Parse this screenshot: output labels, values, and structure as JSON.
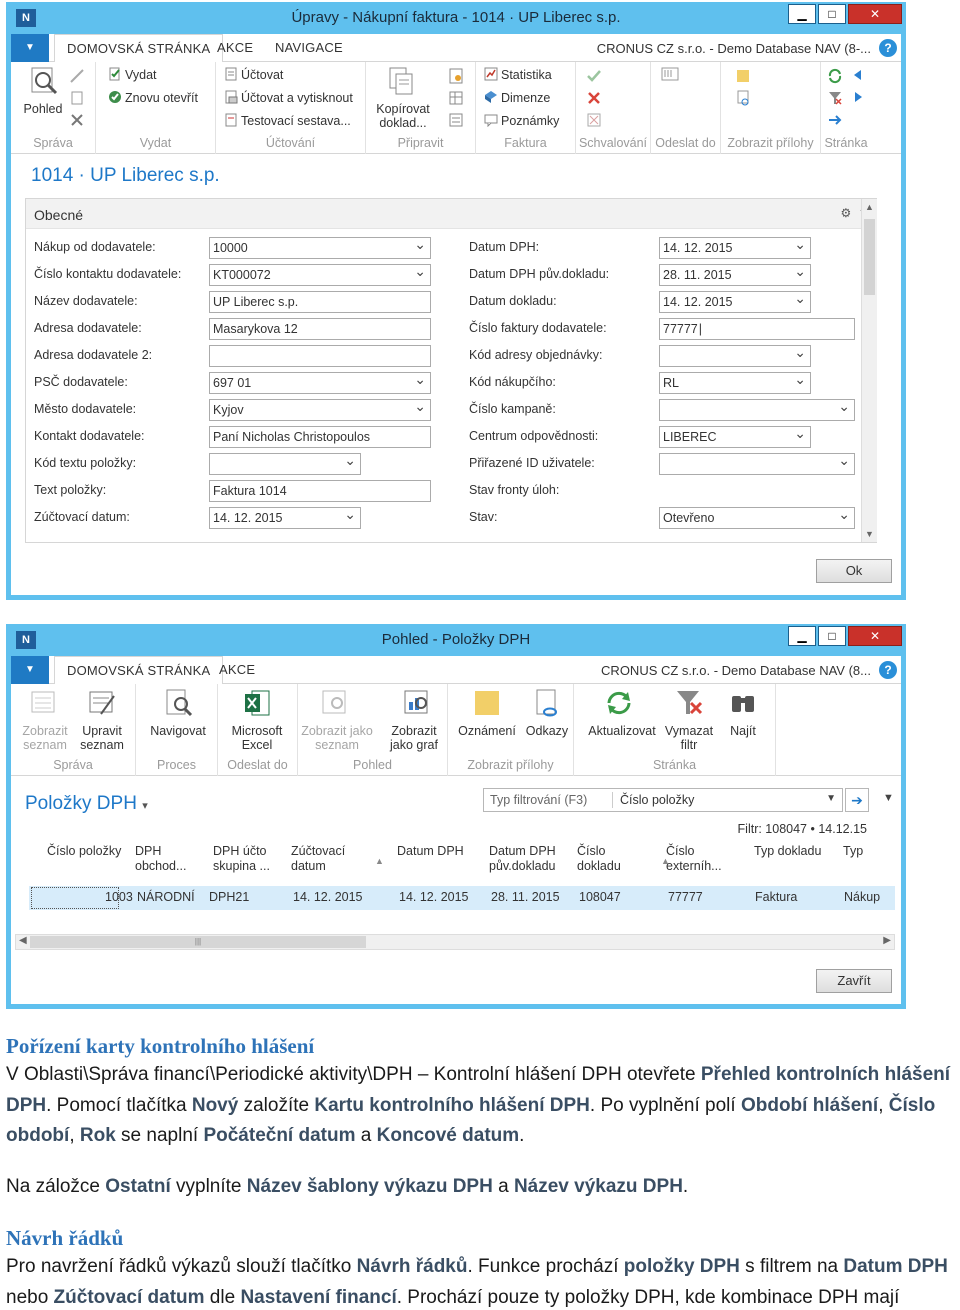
{
  "window1": {
    "title": "Úpravy - Nákupní faktura - 1014 · UP Liberec s.p.",
    "logo": "N",
    "controls": {
      "minimize": "▁",
      "maximize": "□",
      "close": "✕"
    },
    "tabs": [
      "DOMOVSKÁ STRÁNKA",
      "AKCE",
      "NAVIGACE"
    ],
    "company": "CRONUS CZ s.r.o. - Demo Database NAV (8-...",
    "help": "?",
    "ribbon": {
      "sprava": {
        "group": "Správa",
        "view": "Pohled"
      },
      "vydat": {
        "group": "Vydat",
        "post": "Vydat",
        "reopen": "Znovu otevřít"
      },
      "uctovani": {
        "group": "Účtování",
        "post": "Účtovat",
        "post_print": "Účtovat a vytisknout",
        "test": "Testovací sestava..."
      },
      "pripravit": {
        "group": "Připravit",
        "copy": "Kopírovat",
        "copy2": "doklad..."
      },
      "faktura": {
        "group": "Faktura",
        "stats": "Statistika",
        "dims": "Dimenze",
        "notes": "Poznámky"
      },
      "schvalovani": {
        "group": "Schvalování"
      },
      "odeslat": {
        "group": "Odeslat do"
      },
      "prilohy": {
        "group": "Zobrazit přílohy"
      },
      "stranka": {
        "group": "Stránka"
      }
    },
    "record_title": "1014 · UP Liberec s.p.",
    "fasttab": "Obecné",
    "left_fields": [
      {
        "label": "Nákup od dodavatele:",
        "value": "10000"
      },
      {
        "label": "Číslo kontaktu dodavatele:",
        "value": "KT000072"
      },
      {
        "label": "Název dodavatele:",
        "value": "UP Liberec s.p."
      },
      {
        "label": "Adresa dodavatele:",
        "value": "Masarykova 12"
      },
      {
        "label": "Adresa dodavatele 2:",
        "value": ""
      },
      {
        "label": "PSČ dodavatele:",
        "value": "697 01"
      },
      {
        "label": "Město dodavatele:",
        "value": "Kyjov"
      },
      {
        "label": "Kontakt dodavatele:",
        "value": "Paní Nicholas Christopoulos"
      },
      {
        "label": "Kód textu položky:",
        "value": ""
      },
      {
        "label": "Text položky:",
        "value": "Faktura 1014"
      },
      {
        "label": "Zúčtovací datum:",
        "value": "14. 12. 2015"
      }
    ],
    "right_fields": [
      {
        "label": "Datum DPH:",
        "value": "14. 12. 2015"
      },
      {
        "label": "Datum DPH pův.dokladu:",
        "value": "28. 11. 2015"
      },
      {
        "label": "Datum dokladu:",
        "value": "14. 12. 2015"
      },
      {
        "label": "Číslo faktury dodavatele:",
        "value": "77777"
      },
      {
        "label": "Kód adresy objednávky:",
        "value": ""
      },
      {
        "label": "Kód nákupčího:",
        "value": "RL"
      },
      {
        "label": "Číslo kampaně:",
        "value": ""
      },
      {
        "label": "Centrum odpovědnosti:",
        "value": "LIBEREC"
      },
      {
        "label": "Přiřazené ID uživatele:",
        "value": ""
      },
      {
        "label": "Stav fronty úloh:",
        "value": ""
      },
      {
        "label": "Stav:",
        "value": "Otevřeno"
      }
    ],
    "ok": "Ok"
  },
  "window2": {
    "title": "Pohled - Položky DPH",
    "logo": "N",
    "controls": {
      "minimize": "▁",
      "maximize": "□",
      "close": "✕"
    },
    "tabs": [
      "DOMOVSKÁ STRÁNKA",
      "AKCE"
    ],
    "company": "CRONUS CZ s.r.o. - Demo Database NAV (8...",
    "help": "?",
    "ribbon": {
      "sprava": {
        "group": "Správa",
        "show_list": "Zobrazit",
        "show_list2": "seznam",
        "edit_list": "Upravit",
        "edit_list2": "seznam"
      },
      "proces": {
        "group": "Proces",
        "navigate": "Navigovat"
      },
      "odeslat": {
        "group": "Odeslat do",
        "excel": "Microsoft",
        "excel2": "Excel"
      },
      "pohled": {
        "group": "Pohled",
        "as_list": "Zobrazit jako",
        "as_list2": "seznam",
        "as_chart": "Zobrazit",
        "as_chart2": "jako graf"
      },
      "prilohy": {
        "group": "Zobrazit přílohy",
        "notes": "Oznámení",
        "links": "Odkazy"
      },
      "stranka": {
        "group": "Stránka",
        "refresh": "Aktualizovat",
        "clear": "Vymazat",
        "clear2": "filtr",
        "find": "Najít"
      }
    },
    "page_title": "Položky DPH",
    "filter_type": "Typ filtrování (F3)",
    "filter_field": "Číslo položky",
    "filter_text": "Filtr: 108047 • 14.12.15",
    "columns": [
      [
        "Číslo položky",
        ""
      ],
      [
        "DPH",
        "obchod..."
      ],
      [
        "DPH účto",
        "skupina ..."
      ],
      [
        "Zúčtovací",
        "datum"
      ],
      [
        "Datum DPH",
        ""
      ],
      [
        "Datum DPH",
        "pův.dokladu"
      ],
      [
        "Číslo",
        "dokladu"
      ],
      [
        "Číslo",
        "externíh..."
      ],
      [
        "Typ dokladu",
        ""
      ],
      [
        "Typ",
        ""
      ]
    ],
    "row": [
      "1003",
      "NÁRODNÍ",
      "DPH21",
      "14. 12. 2015",
      "14. 12. 2015",
      "28. 11. 2015",
      "108047",
      "77777",
      "Faktura",
      "Nákup"
    ],
    "close": "Zavřít"
  },
  "document": {
    "h1": "Pořízení karty kontrolního hlášení",
    "p1": [
      {
        "t": "V Oblasti\\Správa financí\\Periodické aktivity\\DPH – Kontrolní hlášení DPH otevřete ",
        "b": false
      },
      {
        "t": "Přehled kontrolních hlášení DPH",
        "b": true
      },
      {
        "t": ". Pomocí tlačítka ",
        "b": false
      },
      {
        "t": "Nový",
        "b": true
      },
      {
        "t": " založíte ",
        "b": false
      },
      {
        "t": "Kartu kontrolního hlášení DPH",
        "b": true
      },
      {
        "t": ". Po vyplnění polí ",
        "b": false
      },
      {
        "t": "Období hlášení",
        "b": true
      },
      {
        "t": ", ",
        "b": false
      },
      {
        "t": "Číslo období",
        "b": true
      },
      {
        "t": ", ",
        "b": false
      },
      {
        "t": "Rok",
        "b": true
      },
      {
        "t": " se naplní ",
        "b": false
      },
      {
        "t": "Počáteční datum",
        "b": true
      },
      {
        "t": " a ",
        "b": false
      },
      {
        "t": "Koncové datum",
        "b": true
      },
      {
        "t": ".",
        "b": false
      }
    ],
    "p2": [
      {
        "t": "Na záložce ",
        "b": false
      },
      {
        "t": "Ostatní",
        "b": true
      },
      {
        "t": " vyplníte ",
        "b": false
      },
      {
        "t": "Název šablony výkazu DPH",
        "b": true
      },
      {
        "t": " a ",
        "b": false
      },
      {
        "t": "Název výkazu DPH",
        "b": true
      },
      {
        "t": ".",
        "b": false
      }
    ],
    "h2": "Návrh řádků",
    "p3": [
      {
        "t": "Pro navržení řádků výkazů slouží tlačítko ",
        "b": false
      },
      {
        "t": "Návrh řádků",
        "b": true
      },
      {
        "t": ". Funkce prochází ",
        "b": false
      },
      {
        "t": "položky DPH",
        "b": true
      },
      {
        "t": " s filtrem na ",
        "b": false
      },
      {
        "t": "Datum DPH",
        "b": true
      },
      {
        "t": " nebo ",
        "b": false
      },
      {
        "t": "Zúčtovací datum",
        "b": true
      },
      {
        "t": " dle ",
        "b": false
      },
      {
        "t": "Nastavení financí",
        "b": true
      },
      {
        "t": ". Prochází pouze ty položky DPH, kde kombinace DPH mají",
        "b": false
      }
    ]
  }
}
